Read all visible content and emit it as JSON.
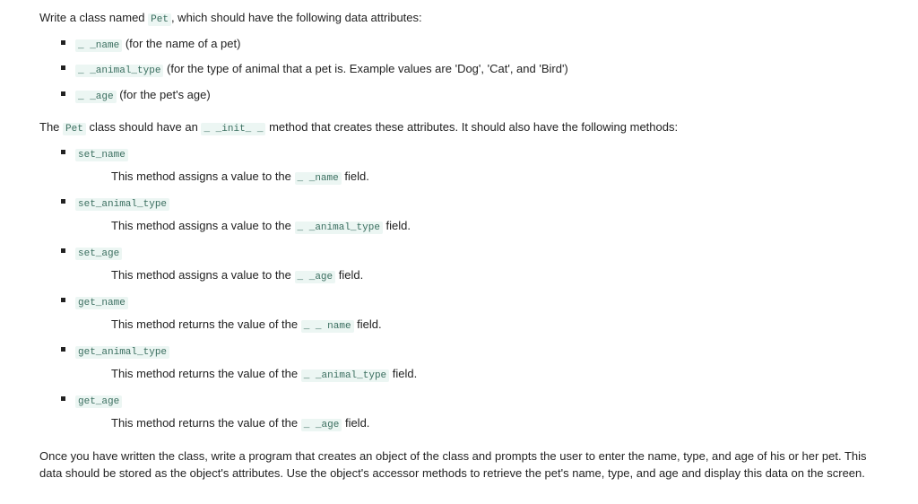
{
  "intro": {
    "text_before": "Write a class named ",
    "class_name": "Pet",
    "text_after": ", which should have the following data attributes:"
  },
  "attrs": [
    {
      "code": "_ _name",
      "desc": " (for the name of a pet)"
    },
    {
      "code": "_ _animal_type",
      "desc": " (for the type of animal that a pet is. Example values are 'Dog', 'Cat', and 'Bird')"
    },
    {
      "code": "_ _age",
      "desc": " (for the pet's age)"
    }
  ],
  "mid": {
    "a": "The ",
    "cls": "Pet",
    "b": " class should have an ",
    "init": "_ _init_ _",
    "c": " method that creates these attributes. It should also have the following methods:"
  },
  "methods": [
    {
      "name": "set_name",
      "desc_a": "This method assigns a value to the ",
      "field": "_ _name",
      "desc_b": " field."
    },
    {
      "name": "set_animal_type",
      "desc_a": "This method assigns a value to the ",
      "field": "_ _animal_type",
      "desc_b": " field."
    },
    {
      "name": "set_age",
      "desc_a": "This method assigns a value to the ",
      "field": "_ _age",
      "desc_b": " field."
    },
    {
      "name": "get_name",
      "desc_a": "This method returns the value of the ",
      "field": "_ _ name",
      "desc_b": " field."
    },
    {
      "name": "get_animal_type",
      "desc_a": "This method returns the value of the ",
      "field": "_ _animal_type",
      "desc_b": " field."
    },
    {
      "name": "get_age",
      "desc_a": "This method returns the value of the ",
      "field": "_ _age",
      "desc_b": " field."
    }
  ],
  "outro": "Once you have written the class, write a program that creates an object of the class and prompts the user to enter the name, type, and age of his or her pet. This data should be stored as the object's attributes. Use the object's accessor methods to retrieve the pet's name, type, and age and display this data on the screen."
}
